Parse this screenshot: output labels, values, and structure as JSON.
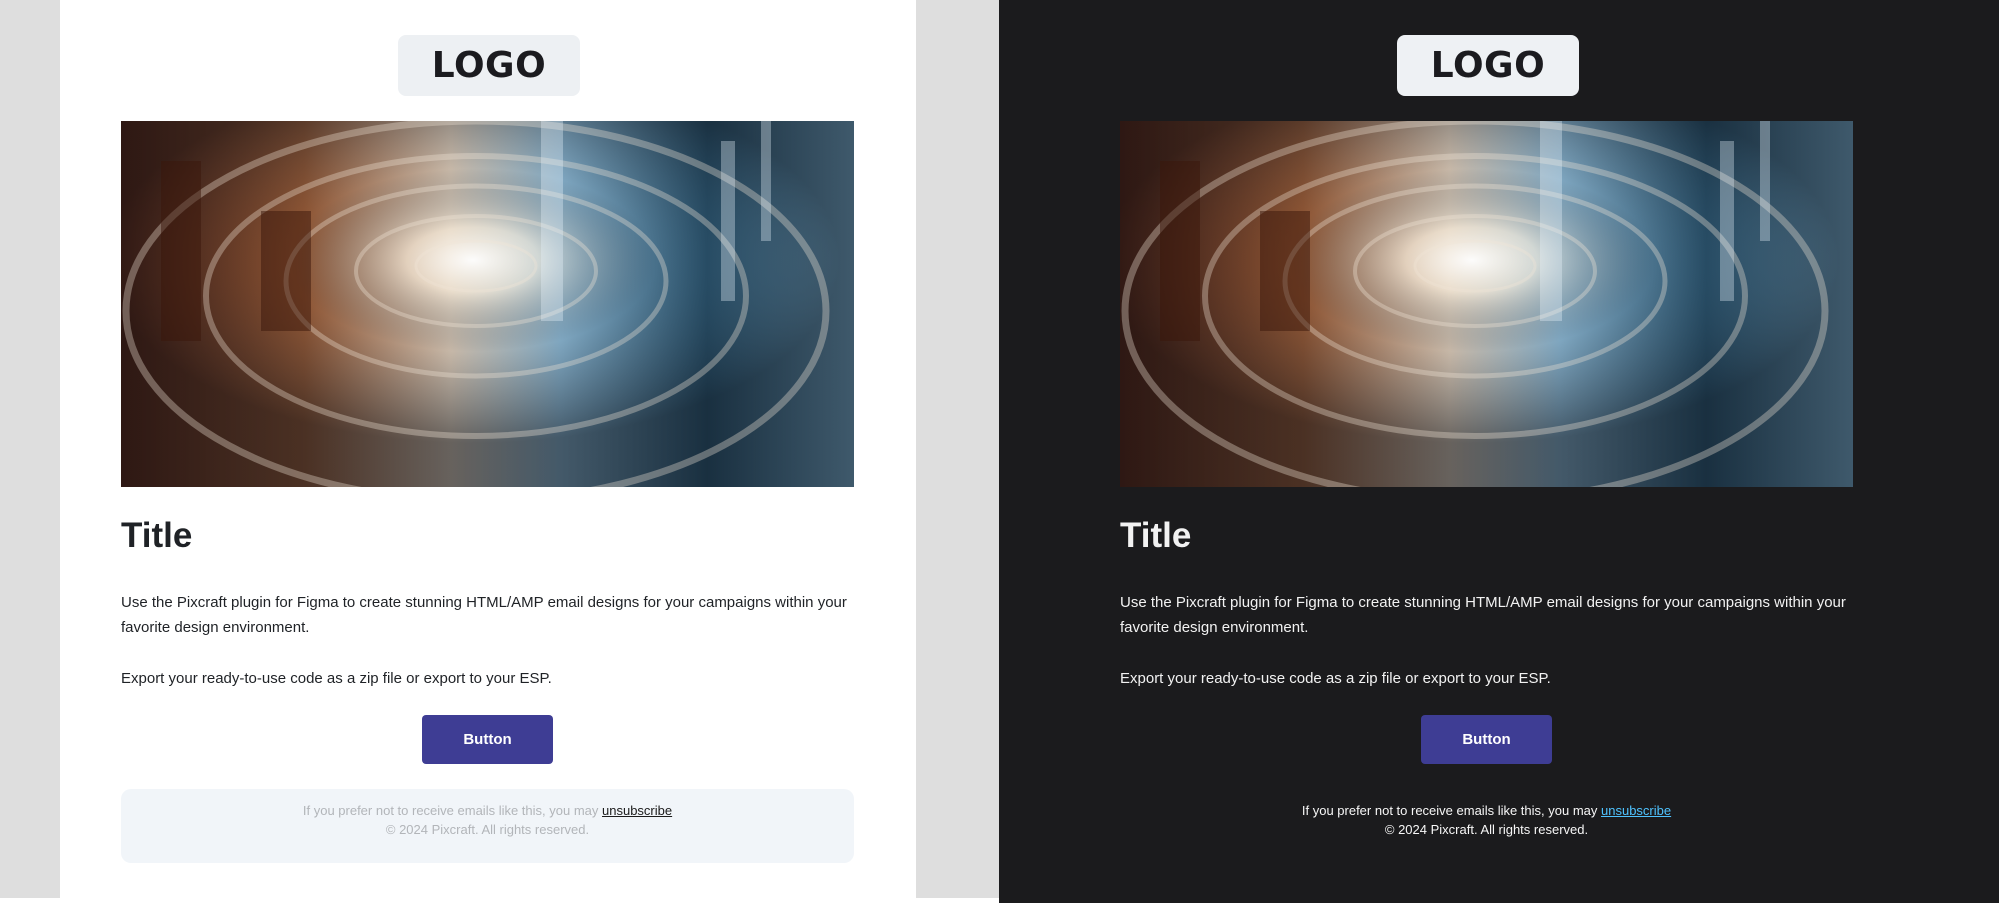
{
  "colors": {
    "light_outer_bg": "#dedede",
    "light_card_bg": "#ffffff",
    "dark_bg": "#1b1b1d",
    "button_bg": "#3e3d94",
    "dark_link": "#4fc3ff"
  },
  "light": {
    "logo": "LOGO",
    "title": "Title",
    "paragraph1": "Use the Pixcraft plugin for Figma to create stunning HTML/AMP email designs for your campaigns within your favorite design environment.",
    "paragraph2": "Export your ready-to-use code as a zip file or export to your ESP.",
    "button": "Button",
    "footer_text": "If you prefer not to receive emails like this, you may",
    "footer_link": "unsubscribe",
    "copyright": "© 2024 Pixcraft. All rights reserved."
  },
  "dark": {
    "logo": "LOGO",
    "title": "Title",
    "paragraph1": "Use the Pixcraft plugin for Figma to create stunning HTML/AMP email designs for your campaigns within your favorite design environment.",
    "paragraph2": "Export your ready-to-use code as a zip file or export to your ESP.",
    "button": "Button",
    "footer_text": "If you prefer not to receive emails like this, you may",
    "footer_link": "unsubscribe",
    "copyright": "© 2024 Pixcraft. All rights reserved."
  },
  "hero_image": "abstract-spiral-architecture-image"
}
